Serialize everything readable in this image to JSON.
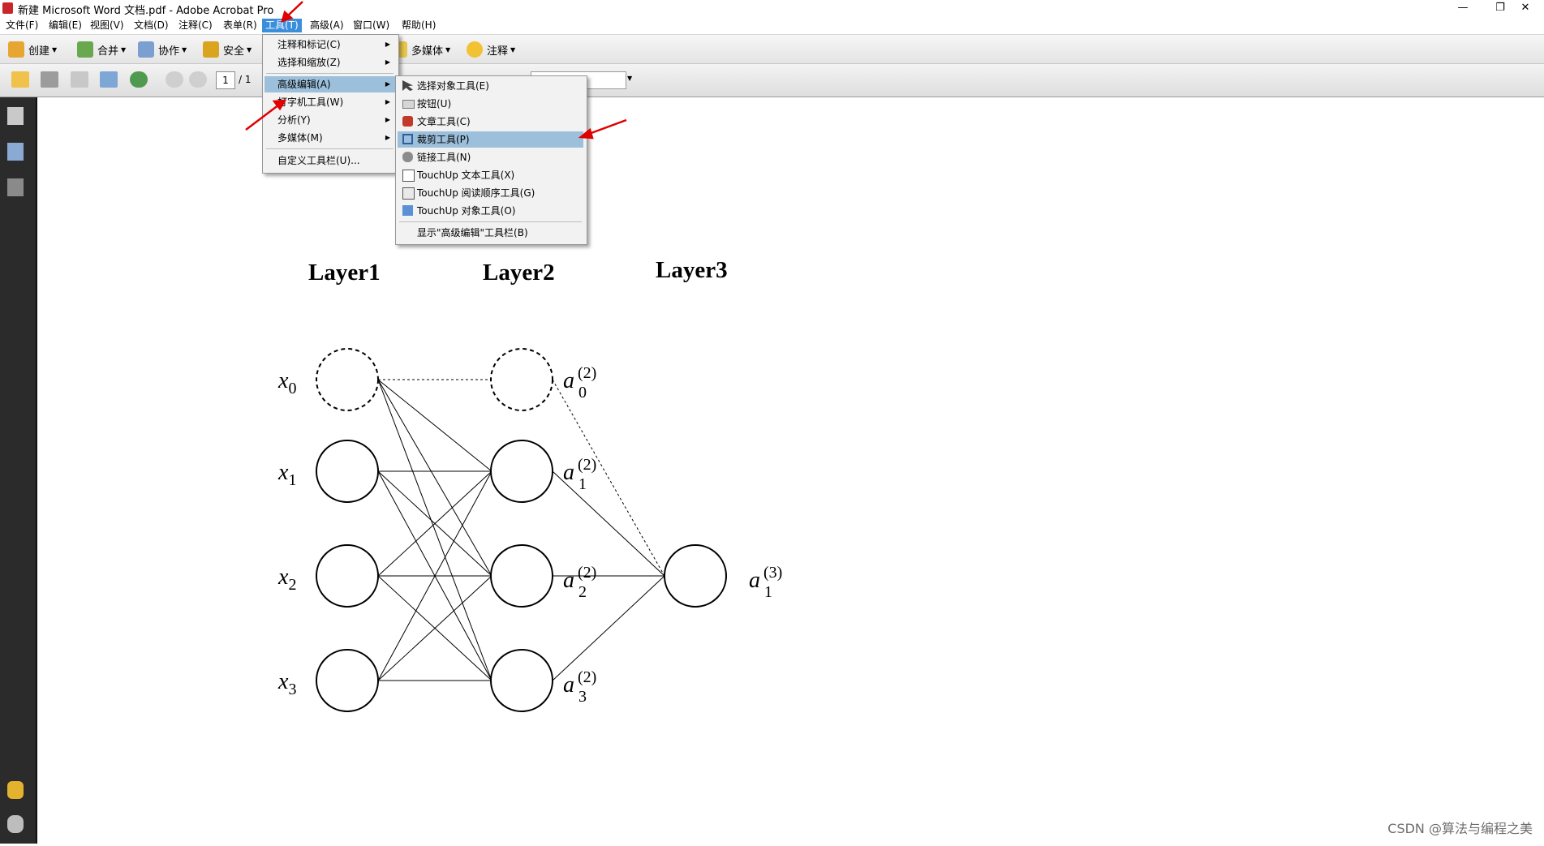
{
  "window": {
    "title": "新建 Microsoft Word 文档.pdf - Adobe Acrobat Pro",
    "minimize": "—",
    "restore": "❐",
    "close": "✕"
  },
  "menubar": [
    "文件(F)",
    "编辑(E)",
    "视图(V)",
    "文档(D)",
    "注释(C)",
    "表单(R)",
    "工具(T)",
    "高级(A)",
    "窗口(W)",
    "帮助(H)"
  ],
  "toolbar1": {
    "create": "创建",
    "combine": "合并",
    "collaborate": "协作",
    "secure": "安全",
    "multimedia": "多媒体",
    "comment": "注释"
  },
  "toolbar2": {
    "page_current": "1",
    "page_total": "/ 1"
  },
  "tools_menu": {
    "items": [
      "注释和标记(C)",
      "选择和缩放(Z)",
      "高级编辑(A)",
      "打字机工具(W)",
      "分析(Y)",
      "多媒体(M)",
      "自定义工具栏(U)..."
    ]
  },
  "adv_menu": {
    "items": [
      "选择对象工具(E)",
      "按钮(U)",
      "文章工具(C)",
      "裁剪工具(P)",
      "链接工具(N)",
      "TouchUp 文本工具(X)",
      "TouchUp 阅读顺序工具(G)",
      "TouchUp 对象工具(O)",
      "显示\"高级编辑\"工具栏(B)"
    ]
  },
  "diagram": {
    "layers": [
      "Layer1",
      "Layer2",
      "Layer3"
    ],
    "inputs": [
      {
        "base": "x",
        "sub": "0"
      },
      {
        "base": "x",
        "sub": "1"
      },
      {
        "base": "x",
        "sub": "2"
      },
      {
        "base": "x",
        "sub": "3"
      }
    ],
    "hidden": [
      {
        "base": "a",
        "sub": "0",
        "sup": "(2)"
      },
      {
        "base": "a",
        "sub": "1",
        "sup": "(2)"
      },
      {
        "base": "a",
        "sub": "2",
        "sup": "(2)"
      },
      {
        "base": "a",
        "sub": "3",
        "sup": "(2)"
      }
    ],
    "output": {
      "base": "a",
      "sub": "1",
      "sup": "(3)"
    }
  },
  "watermark": "CSDN @算法与编程之美",
  "colors": {
    "menu_active": "#3b8edc",
    "menu_highlight": "#9cbfdc",
    "left_panel": "#2b2b2b",
    "annotation_arrow": "#e00000"
  },
  "icons": {
    "pdf_app": "pdf-icon",
    "open": "folder-icon",
    "print": "printer-icon",
    "save": "save-icon",
    "email": "email-icon",
    "web": "globe-icon",
    "prev": "up-arrow-icon",
    "next": "down-arrow-icon"
  }
}
